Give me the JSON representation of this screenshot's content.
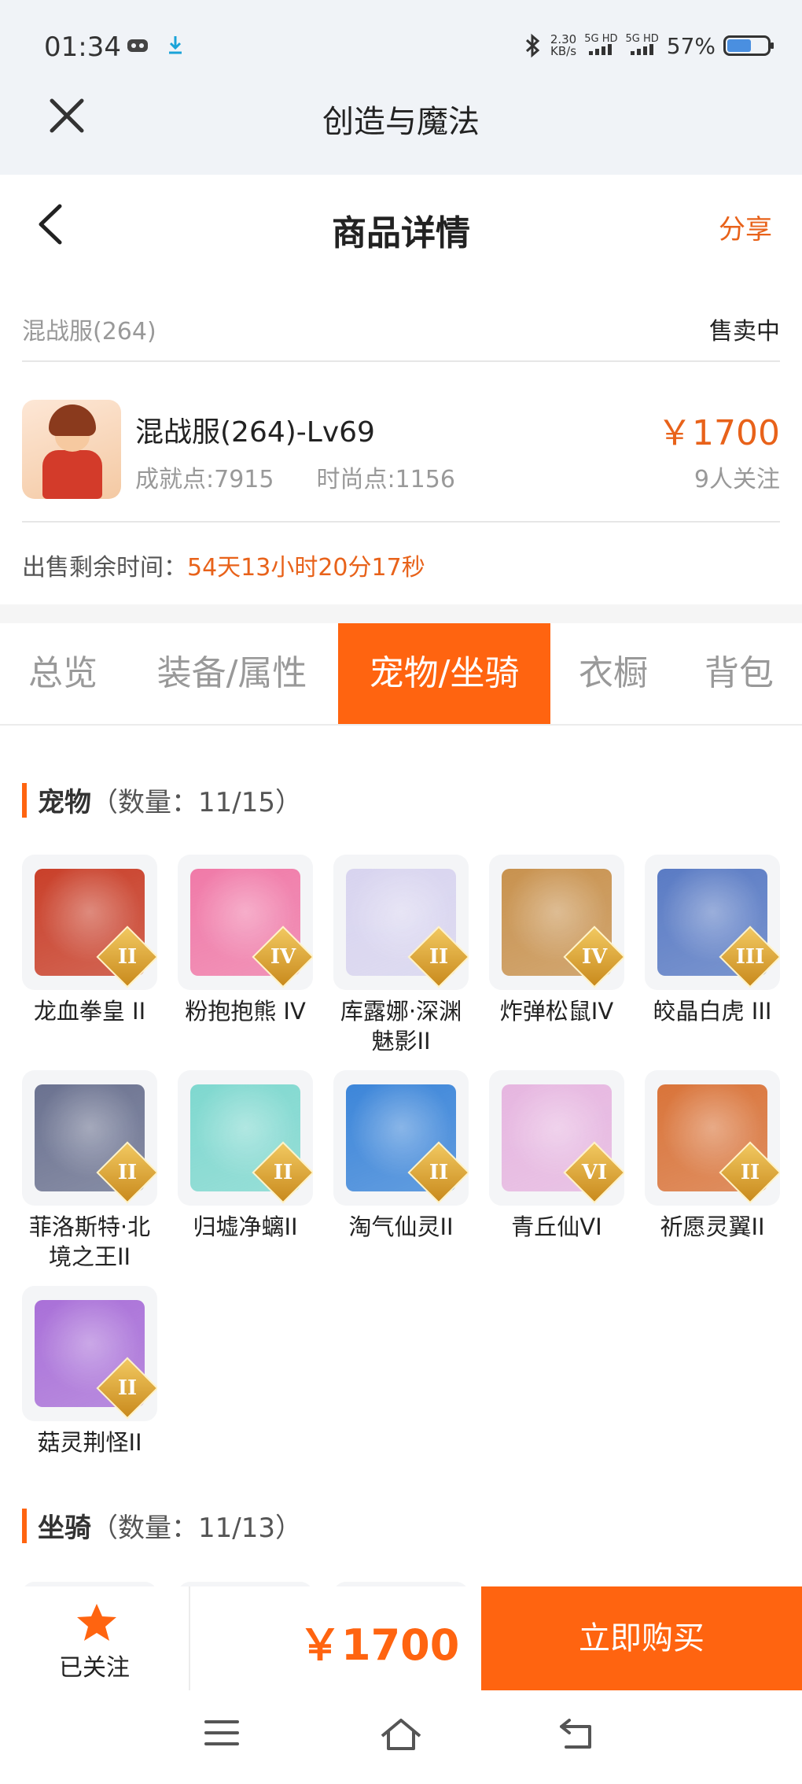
{
  "status_bar": {
    "time": "01:34",
    "net_speed_top": "2.30",
    "net_speed_unit": "KB/s",
    "sim1": "5G HD",
    "sim2": "5G HD",
    "battery": "57%"
  },
  "app": {
    "title": "创造与魔法"
  },
  "nav": {
    "title": "商品详情",
    "share": "分享"
  },
  "server": {
    "name": "混战服(264)",
    "status": "售卖中"
  },
  "item": {
    "title": "混战服(264)-Lv69",
    "achievement": "成就点:7915",
    "fashion": "时尚点:1156",
    "price": "￥1700",
    "watchers": "9人关注"
  },
  "remaining": {
    "label": "出售剩余时间：",
    "value": "54天13小时20分17秒"
  },
  "tabs": [
    {
      "label": "总览"
    },
    {
      "label": "装备/属性"
    },
    {
      "label": "宠物/坐骑"
    },
    {
      "label": "衣橱"
    },
    {
      "label": "背包"
    }
  ],
  "pets_section": {
    "title": "宠物",
    "count": "（数量：11/15）"
  },
  "pets": [
    {
      "name": "龙血拳皇 II",
      "rank": "II",
      "color": "#c9402a"
    },
    {
      "name": "粉抱抱熊 IV",
      "rank": "IV",
      "color": "#f07aa8"
    },
    {
      "name": "库露娜·深渊魅影II",
      "rank": "II",
      "color": "#d8d4ef"
    },
    {
      "name": "炸弹松鼠IV",
      "rank": "IV",
      "color": "#c8924f"
    },
    {
      "name": "皎晶白虎 III",
      "rank": "III",
      "color": "#5a7bc4"
    },
    {
      "name": "菲洛斯特·北境之王II",
      "rank": "II",
      "color": "#6b7290"
    },
    {
      "name": "归墟净螭II",
      "rank": "II",
      "color": "#7fd8cf"
    },
    {
      "name": "淘气仙灵II",
      "rank": "II",
      "color": "#3d86d9"
    },
    {
      "name": "青丘仙VI",
      "rank": "VI",
      "color": "#e6b6e0"
    },
    {
      "name": "祈愿灵翼II",
      "rank": "II",
      "color": "#d9743a"
    },
    {
      "name": "菇灵荆怪II",
      "rank": "II",
      "color": "#a970d8"
    }
  ],
  "mounts_section": {
    "title": "坐骑",
    "count": "（数量：11/13）"
  },
  "bottom": {
    "follow_label": "已关注",
    "price": "￥1700",
    "buy_label": "立即购买"
  }
}
